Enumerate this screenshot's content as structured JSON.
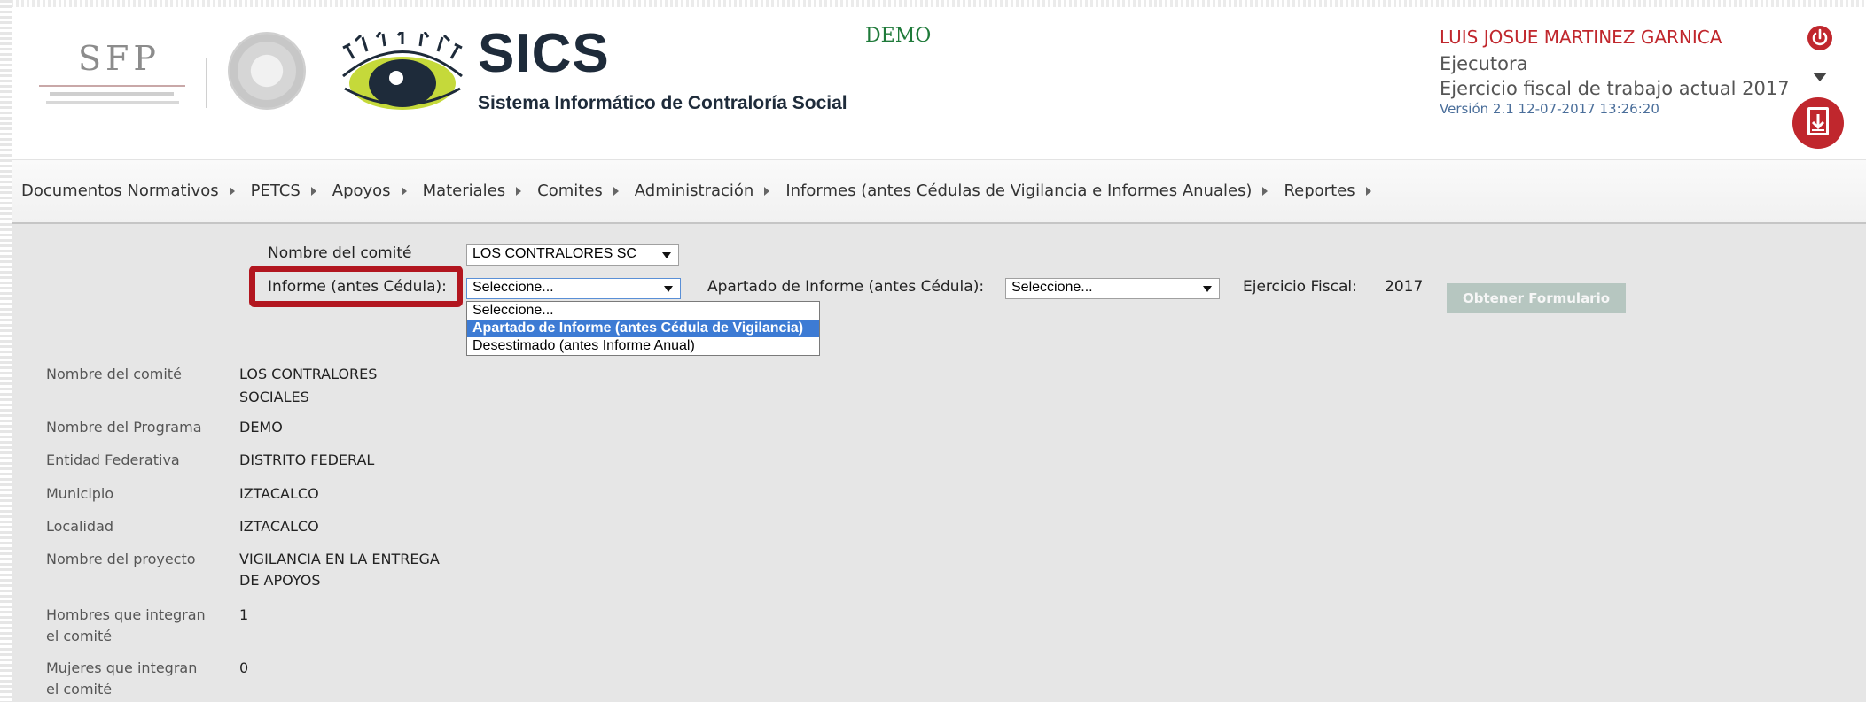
{
  "header": {
    "sfp_logo_text": "SFP",
    "sics_title": "SICS",
    "sics_subtitle": "Sistema Informático de Contraloría Social",
    "demo_label": "DEMO",
    "user": {
      "name": "LUIS JOSUE MARTINEZ GARNICA",
      "role": "Ejecutora",
      "fiscal_year": "Ejercicio fiscal de trabajo actual  2017",
      "version": "Versión 2.1    12-07-2017 13:26:20"
    }
  },
  "menu": {
    "items": [
      {
        "label": "Documentos Normativos"
      },
      {
        "label": "PETCS"
      },
      {
        "label": "Apoyos"
      },
      {
        "label": "Materiales"
      },
      {
        "label": "Comites"
      },
      {
        "label": "Administración"
      },
      {
        "label": "Informes (antes Cédulas de Vigilancia e Informes Anuales)"
      },
      {
        "label": "Reportes"
      }
    ]
  },
  "form": {
    "committee_label": "Nombre del comité",
    "committee_value": "LOS CONTRALORES SC",
    "report_label": "Informe (antes Cédula):",
    "report_value": "Seleccione...",
    "section_label": "Apartado de Informe (antes Cédula):",
    "section_value": "Seleccione...",
    "fiscal_label": "Ejercicio Fiscal:",
    "fiscal_value": "2017",
    "submit_label": "Obtener Formulario",
    "report_options": [
      "Seleccione...",
      "Apartado de Informe (antes Cédula de Vigilancia)",
      "Desestimado (antes Informe Anual)"
    ]
  },
  "details": [
    {
      "label_1": "Nombre del comité",
      "label_2": "",
      "value_1": "LOS CONTRALORES",
      "value_2": "SOCIALES"
    },
    {
      "label_1": "Nombre del Programa",
      "label_2": "",
      "value_1": "DEMO",
      "value_2": ""
    },
    {
      "label_1": "Entidad Federativa",
      "label_2": "",
      "value_1": "DISTRITO FEDERAL",
      "value_2": ""
    },
    {
      "label_1": "Municipio",
      "label_2": "",
      "value_1": "IZTACALCO",
      "value_2": ""
    },
    {
      "label_1": "Localidad",
      "label_2": "",
      "value_1": "IZTACALCO",
      "value_2": ""
    },
    {
      "label_1": "Nombre del proyecto",
      "label_2": "",
      "value_1": "VIGILANCIA EN LA ENTREGA",
      "value_2": "DE APOYOS"
    },
    {
      "label_1": "Hombres que integran",
      "label_2": "el comité",
      "value_1": "1",
      "value_2": ""
    },
    {
      "label_1": "Mujeres que integran",
      "label_2": "el comité",
      "value_1": "0",
      "value_2": ""
    }
  ],
  "colors": {
    "accent_red": "#b2161f",
    "menu_bg": "#f3f3f3",
    "content_bg": "#e6e6e6",
    "selected_option": "#3d7bd4",
    "demo_green": "#1f7a3a"
  },
  "icons": [
    "power-icon",
    "dropdown-caret-icon",
    "download-document-icon",
    "eye-logo-icon",
    "government-seal-icon"
  ]
}
